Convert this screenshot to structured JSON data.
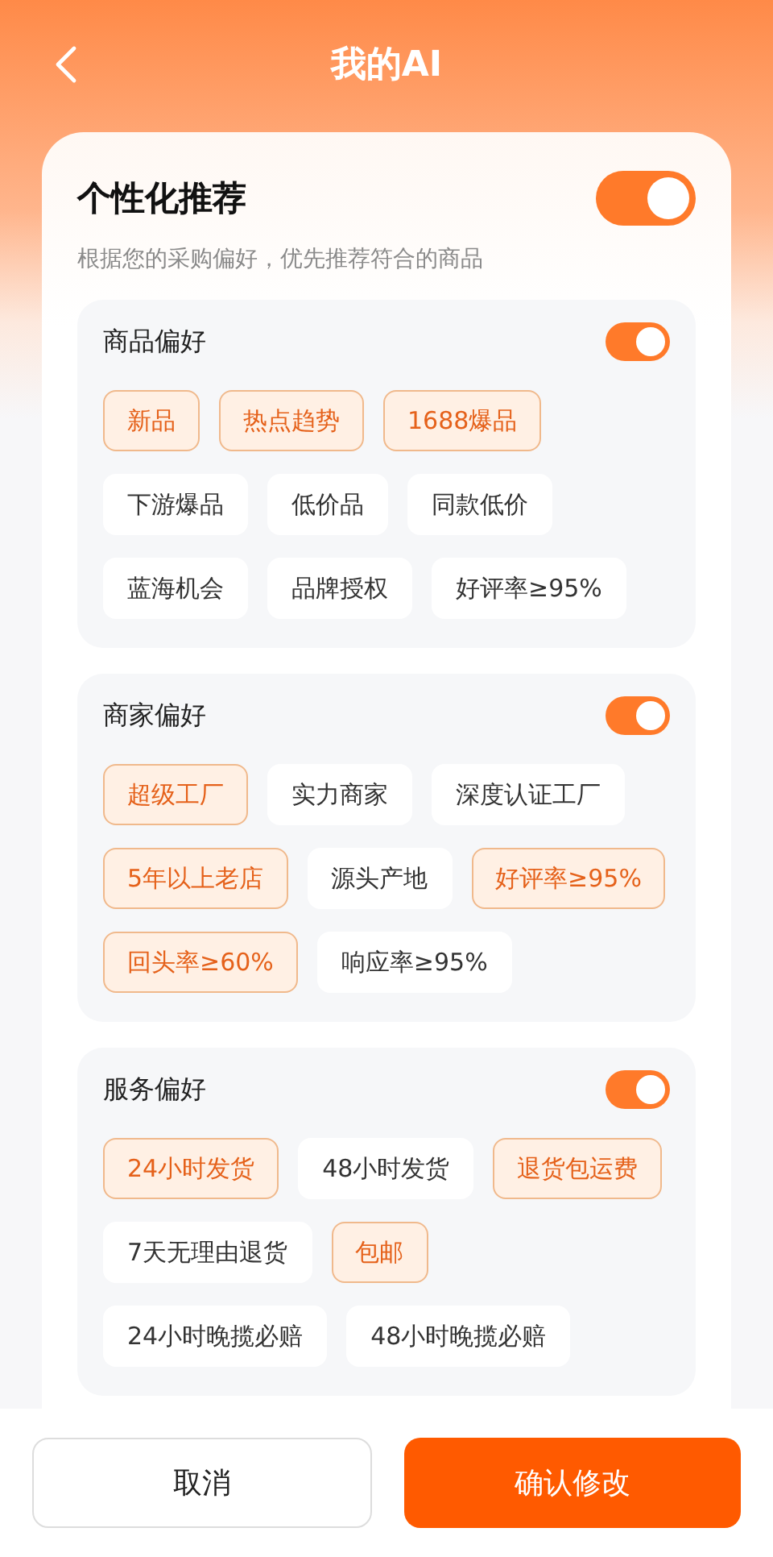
{
  "header": {
    "title": "我的AI"
  },
  "personalized": {
    "title": "个性化推荐",
    "description": "根据您的采购偏好，优先推荐符合的商品",
    "on": true
  },
  "sections": [
    {
      "title": "商品偏好",
      "on": true,
      "tags": [
        {
          "label": "新品",
          "selected": true
        },
        {
          "label": "热点趋势",
          "selected": true
        },
        {
          "label": "1688爆品",
          "selected": true
        },
        {
          "label": "下游爆品",
          "selected": false
        },
        {
          "label": "低价品",
          "selected": false
        },
        {
          "label": "同款低价",
          "selected": false
        },
        {
          "label": "蓝海机会",
          "selected": false
        },
        {
          "label": "品牌授权",
          "selected": false
        },
        {
          "label": "好评率≥95%",
          "selected": false
        }
      ]
    },
    {
      "title": "商家偏好",
      "on": true,
      "tags": [
        {
          "label": "超级工厂",
          "selected": true
        },
        {
          "label": "实力商家",
          "selected": false
        },
        {
          "label": "深度认证工厂",
          "selected": false
        },
        {
          "label": "5年以上老店",
          "selected": true
        },
        {
          "label": "源头产地",
          "selected": false
        },
        {
          "label": "好评率≥95%",
          "selected": true
        },
        {
          "label": "回头率≥60%",
          "selected": true
        },
        {
          "label": "响应率≥95%",
          "selected": false
        }
      ]
    },
    {
      "title": "服务偏好",
      "on": true,
      "tags": [
        {
          "label": "24小时发货",
          "selected": true
        },
        {
          "label": "48小时发货",
          "selected": false
        },
        {
          "label": "退货包运费",
          "selected": true
        },
        {
          "label": "7天无理由退货",
          "selected": false
        },
        {
          "label": "包邮",
          "selected": true
        },
        {
          "label": "24小时晚揽必赔",
          "selected": false
        },
        {
          "label": "48小时晚揽必赔",
          "selected": false
        }
      ]
    }
  ],
  "buttons": [
    {
      "label": "取消",
      "kind": "secondary"
    },
    {
      "label": "确认修改",
      "kind": "primary"
    }
  ]
}
